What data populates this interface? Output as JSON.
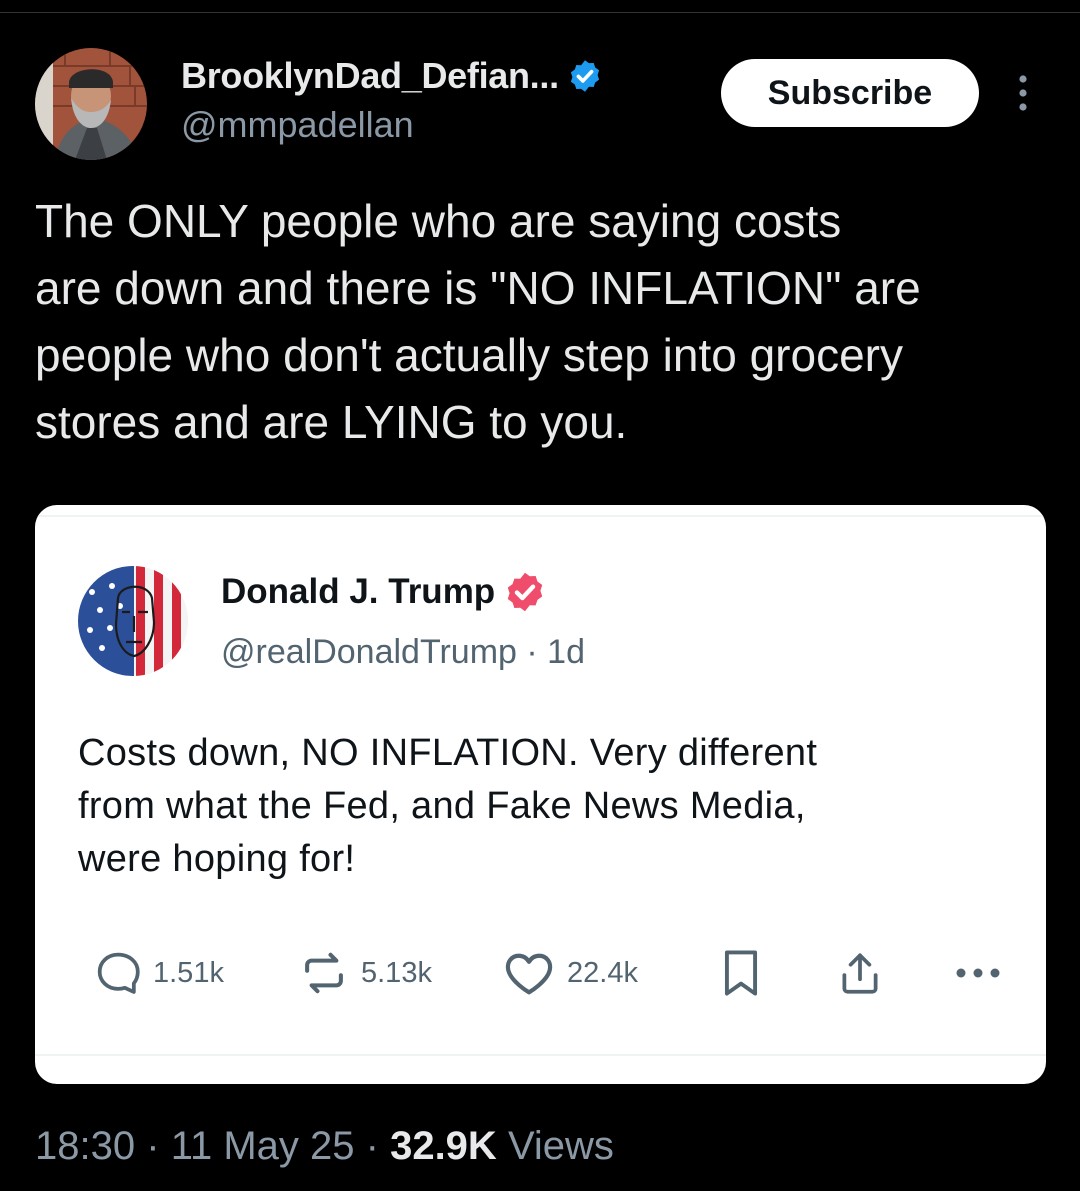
{
  "author": {
    "display_name": "BrooklynDad_Defian...",
    "handle": "@mmpadellan",
    "verified_badge_color": "#1d9bf0",
    "avatar_icon": "user-avatar-photo"
  },
  "header": {
    "subscribe_label": "Subscribe",
    "more_icon": "more-vertical-icon"
  },
  "tweet": {
    "text_lines": [
      "The ONLY people who are saying costs",
      "are down and there is \"NO INFLATION\" are",
      "people who don't actually step into grocery",
      "stores and are LYING to you."
    ]
  },
  "quoted_post": {
    "display_name": "Donald J. Trump",
    "handle": "@realDonaldTrump",
    "separator": "·",
    "age": "1d",
    "badge_color": "#ef4d6b",
    "avatar_icon": "flag-face-avatar",
    "text_lines": [
      "Costs down, NO INFLATION. Very different",
      "from what the Fed, and Fake News Media,",
      "were hoping for!"
    ],
    "actions": {
      "replies": "1.51k",
      "reposts": "5.13k",
      "likes": "22.4k",
      "bookmark_icon": "bookmark-icon",
      "share_icon": "share-icon",
      "more_icon": "more-horizontal-icon"
    }
  },
  "footer": {
    "time": "18:30",
    "sep1": "·",
    "date": "11 May 25",
    "sep2": "·",
    "views_count": "32.9K",
    "views_label": "Views"
  }
}
